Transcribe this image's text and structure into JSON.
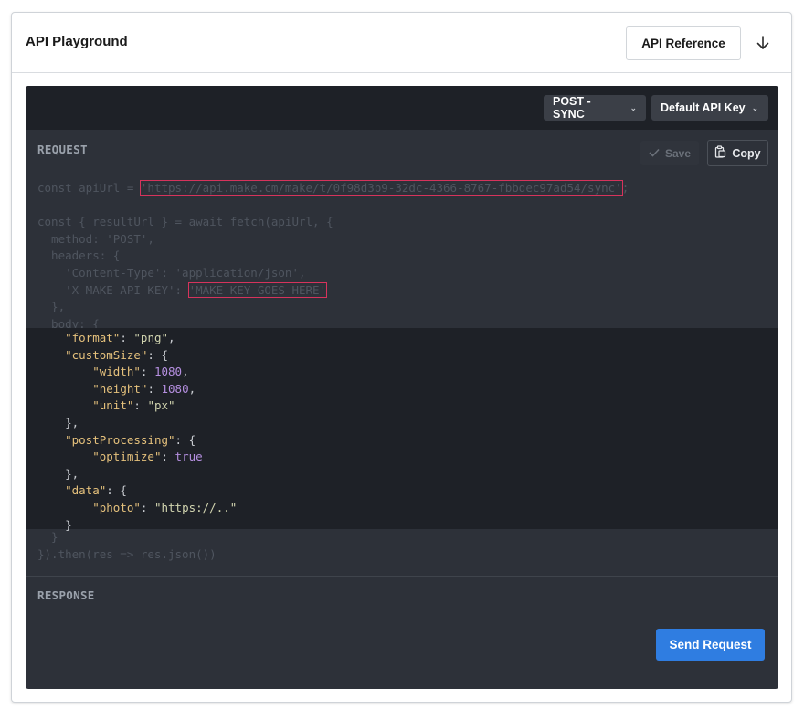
{
  "header": {
    "title": "API Playground",
    "api_reference_label": "API Reference",
    "download_icon": "arrow-down-icon"
  },
  "toolbar": {
    "mode_select": "POST - SYNC",
    "key_select": "Default API Key",
    "chevron_icon": "chevron-down-icon"
  },
  "request": {
    "label": "REQUEST",
    "save_label": "Save",
    "copy_label": "Copy",
    "save_icon": "check-icon",
    "copy_icon": "clipboard-icon",
    "code": {
      "api_url_prefix": "const apiUrl = ",
      "api_url": "'https://api.make.cm/make/t/0f98d3b9-32dc-4366-8767-fbbdec97ad54/sync'",
      "api_url_suffix": ";",
      "fetch_line": "const { resultUrl } = await fetch(apiUrl, {",
      "method_line": "  method: 'POST',",
      "headers_open": "  headers: {",
      "content_type_line": "    'Content-Type': 'application/json',",
      "api_key_prefix": "    'X-MAKE-API-KEY': ",
      "api_key_value": "'MAKE KEY GOES HERE'",
      "headers_close": "  },",
      "body_open": "  body: {",
      "body_close": "  }",
      "then_line": "}).then(res => res.json())",
      "body_json": {
        "format_key": "\"format\"",
        "format_value": "\"png\"",
        "custom_size_key": "\"customSize\"",
        "width_key": "\"width\"",
        "width_value": "1080",
        "height_key": "\"height\"",
        "height_value": "1080",
        "unit_key": "\"unit\"",
        "unit_value": "\"px\"",
        "post_processing_key": "\"postProcessing\"",
        "optimize_key": "\"optimize\"",
        "optimize_value": "true",
        "data_key": "\"data\"",
        "photo_key": "\"photo\"",
        "photo_value": "\"https://..\""
      }
    }
  },
  "response": {
    "label": "RESPONSE",
    "send_label": "Send Request"
  },
  "colors": {
    "accent": "#2f7de1",
    "highlight_border": "#d6335c",
    "panel_bg": "#2d3139",
    "toolbar_bg": "#1e2127",
    "json_key": "#e5c17c",
    "json_number": "#b58fe0"
  }
}
